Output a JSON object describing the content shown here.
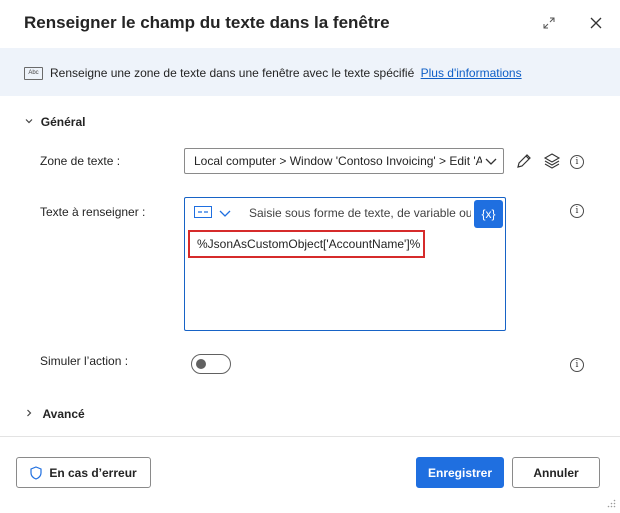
{
  "dialog": {
    "title": "Renseigner le champ du texte dans la fenêtre",
    "banner": {
      "text": "Renseigne une zone de texte dans une fenêtre avec le texte spécifié",
      "link": "Plus d'informations",
      "icon": "text-abc-icon",
      "icon_text": "Abc"
    }
  },
  "general": {
    "header": "Général",
    "zone_label": "Zone de texte :",
    "zone_value": "Local computer > Window 'Contoso Invoicing' > Edit 'Account Name'",
    "texte_label": "Texte à renseigner :",
    "texte_placeholder": "Saisie sous forme de texte, de variable ou",
    "var_button": "{x}",
    "texte_value": "%JsonAsCustomObject['AccountName']%",
    "simuler_label": "Simuler l’action :",
    "simuler_on": false
  },
  "advanced": {
    "header": "Avancé"
  },
  "footer": {
    "error_button": "En cas d’erreur",
    "save_button": "Enregistrer",
    "cancel_button": "Annuler"
  },
  "colors": {
    "accent": "#1f6fe0",
    "highlight": "#d62b2b",
    "banner_bg": "#eef3fa"
  }
}
